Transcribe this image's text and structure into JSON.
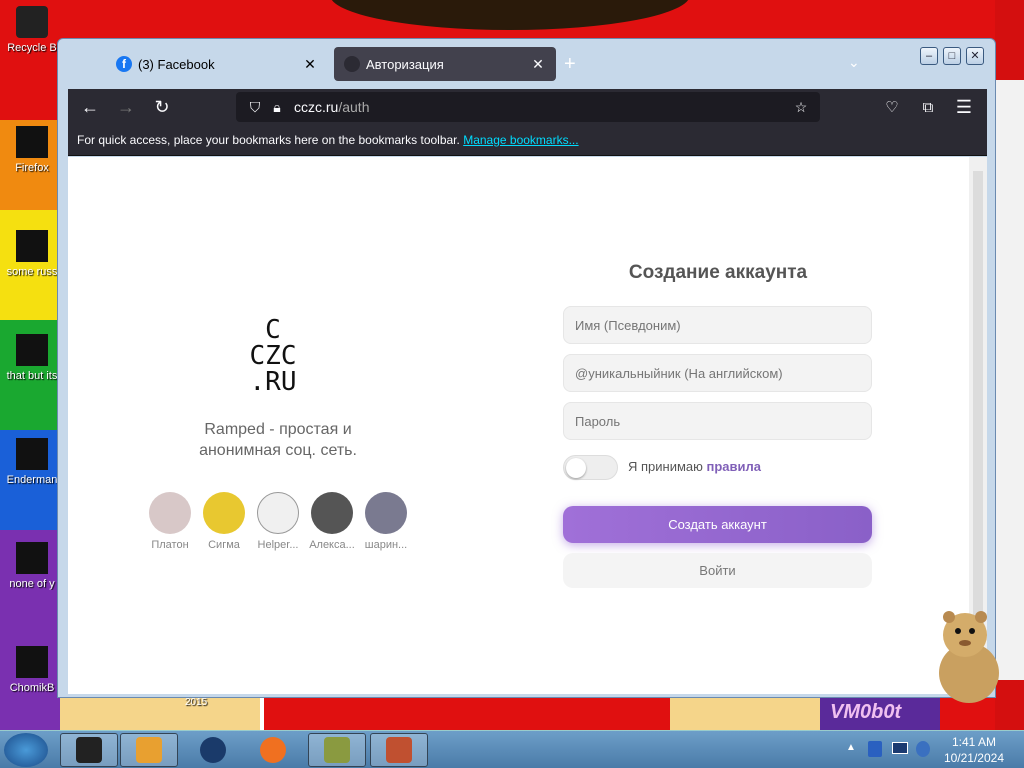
{
  "desktop": {
    "icons": [
      {
        "label": "Recycle Bin",
        "short": "Recycle B"
      },
      {
        "label": "Firefox",
        "short": "Firefox"
      },
      {
        "label": "some russ... ran a ra...",
        "short": "some russ"
      },
      {
        "label": "that but it's",
        "short": "that but its"
      },
      {
        "label": "Enderman",
        "short": "Enderman"
      },
      {
        "label": "none of y... retards kn...",
        "short": "none of y"
      },
      {
        "label": "ChomikB",
        "short": "ChomikB"
      }
    ],
    "wallpaper_text": "VM0b0t",
    "wallpaper_small_text": "2015"
  },
  "browser": {
    "tabs": [
      {
        "label": "(3) Facebook",
        "icon": "facebook-icon",
        "active": false
      },
      {
        "label": "Авторизация",
        "icon": "site-icon",
        "active": true
      }
    ],
    "url_host": "cczc.ru",
    "url_path": "/auth",
    "bookmarks_hint": "For quick access, place your bookmarks here on the bookmarks toolbar.",
    "bookmarks_link": "Manage bookmarks..."
  },
  "page": {
    "logo": {
      "line1": "C",
      "line2": "CZC",
      "line3": ".RU"
    },
    "tagline": "Ramped - простая и анонимная соц. сеть.",
    "users": [
      {
        "name": "Платон",
        "color": "#d8c8c8"
      },
      {
        "name": "Сигма",
        "color": "#e8c830"
      },
      {
        "name": "Helper...",
        "color": "#f0f0f0"
      },
      {
        "name": "Алекса...",
        "color": "#555555"
      },
      {
        "name": "шарин...",
        "color": "#7a7a90"
      }
    ],
    "form": {
      "title": "Создание аккаунта",
      "name_placeholder": "Имя (Псевдоним)",
      "username_placeholder": "@уникальныйник (На английском)",
      "password_placeholder": "Пароль",
      "accept_text": "Я принимаю",
      "accept_link": "правила",
      "create_button": "Создать аккаунт",
      "login_button": "Войти"
    }
  },
  "taskbar": {
    "time": "1:41 AM",
    "date": "10/21/2024"
  },
  "colors": {
    "accent_purple": "#8a60c8",
    "firefox_toolbar": "#2b2a33",
    "link_cyan": "#00ddff"
  }
}
